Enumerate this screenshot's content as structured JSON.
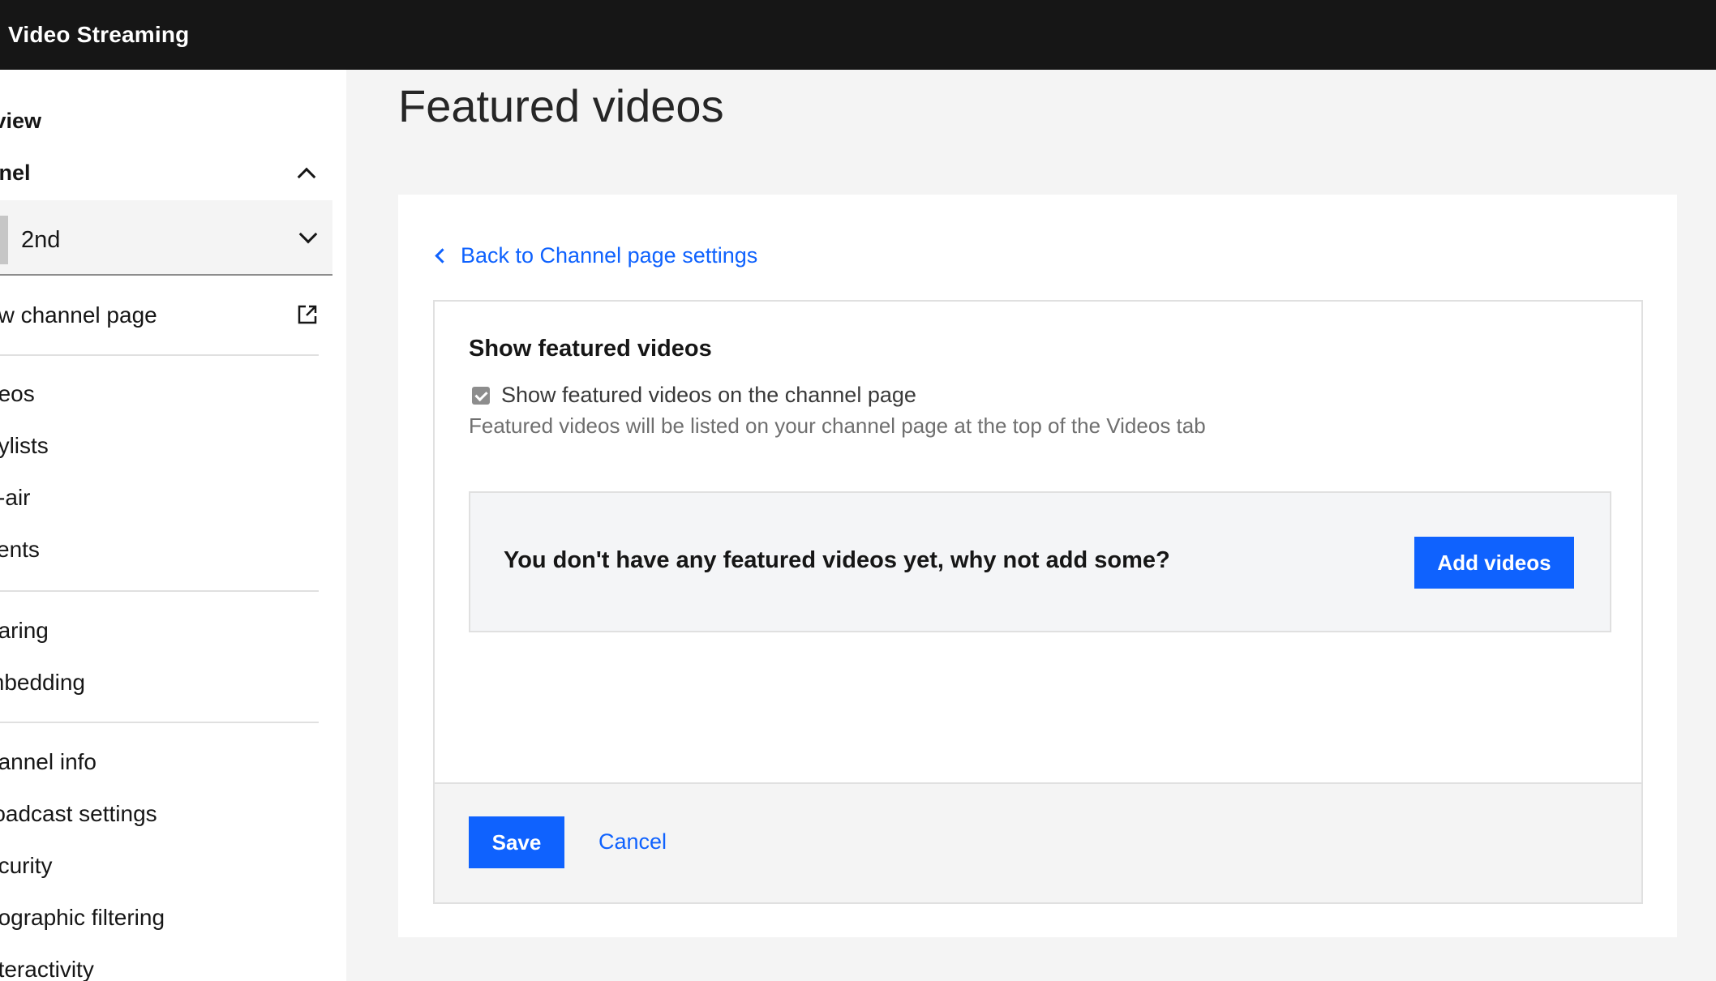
{
  "header": {
    "title": "Video Streaming"
  },
  "sidebar": {
    "overview_label": "rview",
    "channel_label": "nnel",
    "channel_select": {
      "value": "2nd"
    },
    "view_channel_label": "ew channel page",
    "groups": [
      {
        "items": [
          "deos",
          "aylists",
          "ff-air",
          "vents"
        ]
      },
      {
        "items": [
          "haring",
          "mbedding"
        ]
      },
      {
        "items": [
          "hannel info",
          "roadcast settings",
          "ecurity",
          "eographic filtering",
          "nteractivity"
        ]
      }
    ]
  },
  "main": {
    "page_title": "Featured videos",
    "back_link": "Back to Channel page settings",
    "panel": {
      "title": "Show featured videos",
      "checkbox_label": "Show featured videos on the channel page",
      "checkbox_checked": true,
      "helper_text": "Featured videos will be listed on your channel page at the top of the Videos tab",
      "empty_message": "You don't have any featured videos yet, why not add some?",
      "add_button": "Add videos"
    },
    "footer": {
      "save_label": "Save",
      "cancel_label": "Cancel"
    }
  },
  "colors": {
    "accent": "#0f62fe",
    "header_bg": "#161616",
    "page_bg": "#f4f4f4"
  }
}
